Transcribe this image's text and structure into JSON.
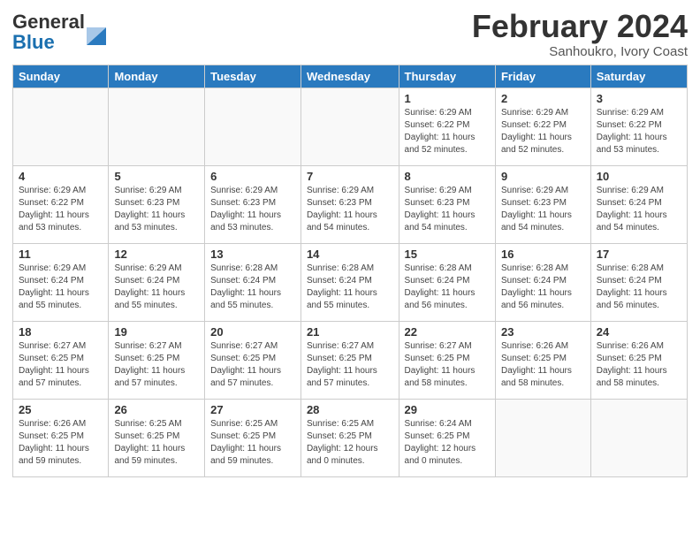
{
  "header": {
    "logo_general": "General",
    "logo_blue": "Blue",
    "title": "February 2024",
    "subtitle": "Sanhoukro, Ivory Coast"
  },
  "days_of_week": [
    "Sunday",
    "Monday",
    "Tuesday",
    "Wednesday",
    "Thursday",
    "Friday",
    "Saturday"
  ],
  "weeks": [
    [
      {
        "day": "",
        "info": ""
      },
      {
        "day": "",
        "info": ""
      },
      {
        "day": "",
        "info": ""
      },
      {
        "day": "",
        "info": ""
      },
      {
        "day": "1",
        "info": "Sunrise: 6:29 AM\nSunset: 6:22 PM\nDaylight: 11 hours\nand 52 minutes."
      },
      {
        "day": "2",
        "info": "Sunrise: 6:29 AM\nSunset: 6:22 PM\nDaylight: 11 hours\nand 52 minutes."
      },
      {
        "day": "3",
        "info": "Sunrise: 6:29 AM\nSunset: 6:22 PM\nDaylight: 11 hours\nand 53 minutes."
      }
    ],
    [
      {
        "day": "4",
        "info": "Sunrise: 6:29 AM\nSunset: 6:22 PM\nDaylight: 11 hours\nand 53 minutes."
      },
      {
        "day": "5",
        "info": "Sunrise: 6:29 AM\nSunset: 6:23 PM\nDaylight: 11 hours\nand 53 minutes."
      },
      {
        "day": "6",
        "info": "Sunrise: 6:29 AM\nSunset: 6:23 PM\nDaylight: 11 hours\nand 53 minutes."
      },
      {
        "day": "7",
        "info": "Sunrise: 6:29 AM\nSunset: 6:23 PM\nDaylight: 11 hours\nand 54 minutes."
      },
      {
        "day": "8",
        "info": "Sunrise: 6:29 AM\nSunset: 6:23 PM\nDaylight: 11 hours\nand 54 minutes."
      },
      {
        "day": "9",
        "info": "Sunrise: 6:29 AM\nSunset: 6:23 PM\nDaylight: 11 hours\nand 54 minutes."
      },
      {
        "day": "10",
        "info": "Sunrise: 6:29 AM\nSunset: 6:24 PM\nDaylight: 11 hours\nand 54 minutes."
      }
    ],
    [
      {
        "day": "11",
        "info": "Sunrise: 6:29 AM\nSunset: 6:24 PM\nDaylight: 11 hours\nand 55 minutes."
      },
      {
        "day": "12",
        "info": "Sunrise: 6:29 AM\nSunset: 6:24 PM\nDaylight: 11 hours\nand 55 minutes."
      },
      {
        "day": "13",
        "info": "Sunrise: 6:28 AM\nSunset: 6:24 PM\nDaylight: 11 hours\nand 55 minutes."
      },
      {
        "day": "14",
        "info": "Sunrise: 6:28 AM\nSunset: 6:24 PM\nDaylight: 11 hours\nand 55 minutes."
      },
      {
        "day": "15",
        "info": "Sunrise: 6:28 AM\nSunset: 6:24 PM\nDaylight: 11 hours\nand 56 minutes."
      },
      {
        "day": "16",
        "info": "Sunrise: 6:28 AM\nSunset: 6:24 PM\nDaylight: 11 hours\nand 56 minutes."
      },
      {
        "day": "17",
        "info": "Sunrise: 6:28 AM\nSunset: 6:24 PM\nDaylight: 11 hours\nand 56 minutes."
      }
    ],
    [
      {
        "day": "18",
        "info": "Sunrise: 6:27 AM\nSunset: 6:25 PM\nDaylight: 11 hours\nand 57 minutes."
      },
      {
        "day": "19",
        "info": "Sunrise: 6:27 AM\nSunset: 6:25 PM\nDaylight: 11 hours\nand 57 minutes."
      },
      {
        "day": "20",
        "info": "Sunrise: 6:27 AM\nSunset: 6:25 PM\nDaylight: 11 hours\nand 57 minutes."
      },
      {
        "day": "21",
        "info": "Sunrise: 6:27 AM\nSunset: 6:25 PM\nDaylight: 11 hours\nand 57 minutes."
      },
      {
        "day": "22",
        "info": "Sunrise: 6:27 AM\nSunset: 6:25 PM\nDaylight: 11 hours\nand 58 minutes."
      },
      {
        "day": "23",
        "info": "Sunrise: 6:26 AM\nSunset: 6:25 PM\nDaylight: 11 hours\nand 58 minutes."
      },
      {
        "day": "24",
        "info": "Sunrise: 6:26 AM\nSunset: 6:25 PM\nDaylight: 11 hours\nand 58 minutes."
      }
    ],
    [
      {
        "day": "25",
        "info": "Sunrise: 6:26 AM\nSunset: 6:25 PM\nDaylight: 11 hours\nand 59 minutes."
      },
      {
        "day": "26",
        "info": "Sunrise: 6:25 AM\nSunset: 6:25 PM\nDaylight: 11 hours\nand 59 minutes."
      },
      {
        "day": "27",
        "info": "Sunrise: 6:25 AM\nSunset: 6:25 PM\nDaylight: 11 hours\nand 59 minutes."
      },
      {
        "day": "28",
        "info": "Sunrise: 6:25 AM\nSunset: 6:25 PM\nDaylight: 12 hours\nand 0 minutes."
      },
      {
        "day": "29",
        "info": "Sunrise: 6:24 AM\nSunset: 6:25 PM\nDaylight: 12 hours\nand 0 minutes."
      },
      {
        "day": "",
        "info": ""
      },
      {
        "day": "",
        "info": ""
      }
    ]
  ]
}
